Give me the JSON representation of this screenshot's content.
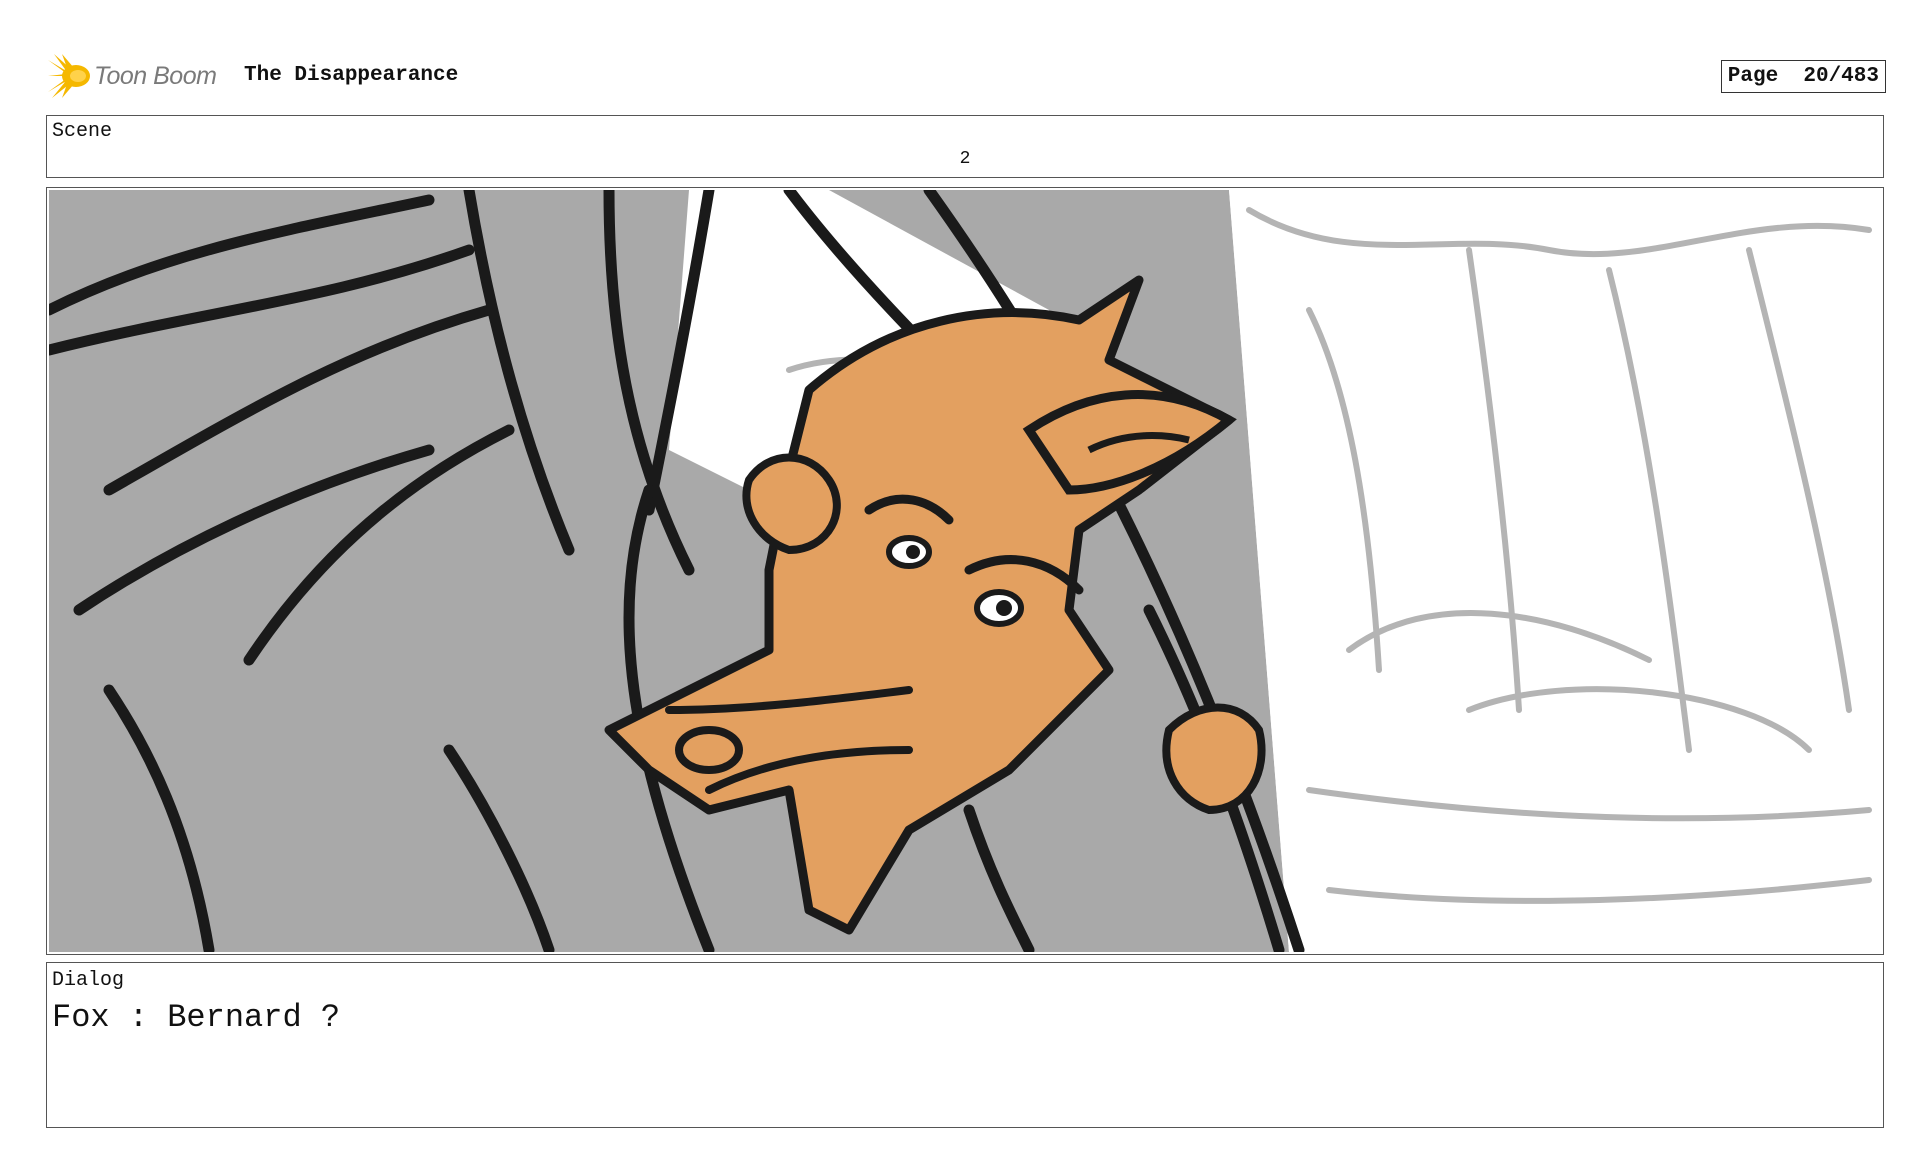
{
  "header": {
    "logo_text": "Toon Boom",
    "logo_icon": "starburst-icon",
    "title": "The Disappearance",
    "page_label": "Page  20/483"
  },
  "scene": {
    "label": "Scene",
    "number": "2"
  },
  "panel": {
    "description_colors": {
      "shadow_gray": "#a8a8a8",
      "fox_orange": "#e3a060",
      "line_black": "#1a1a1a",
      "sketch_gray": "#b4b4b4"
    }
  },
  "dialog": {
    "label": "Dialog",
    "text": "Fox : Bernard ?"
  },
  "colors": {
    "logo_yellow": "#f5b800",
    "border": "#555555"
  }
}
